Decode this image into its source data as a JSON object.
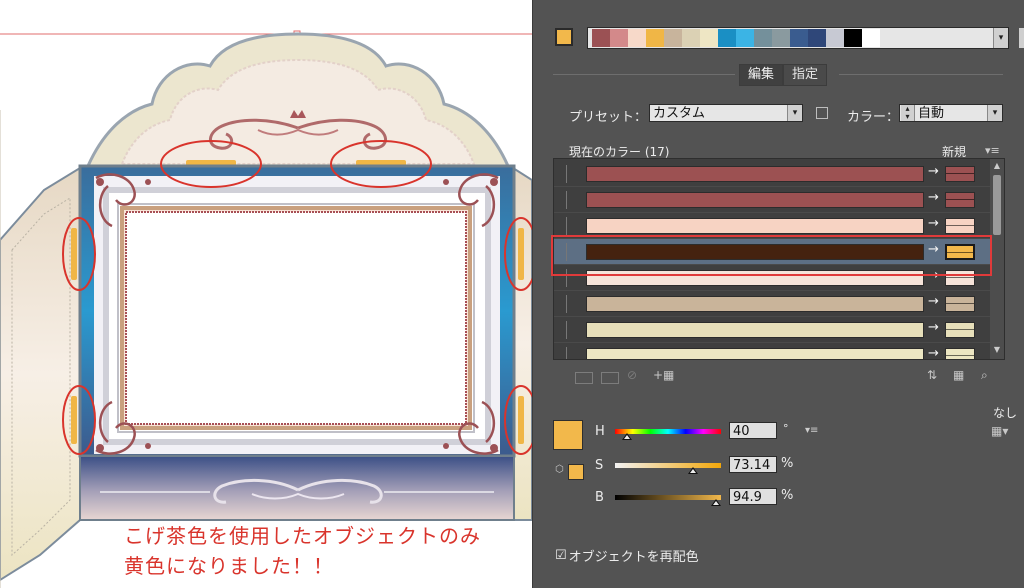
{
  "annotation": {
    "line1": "こげ茶色を使用したオブジェクトのみ",
    "line2": "黄色になりました！！"
  },
  "colors": {
    "accent_yellow": "#f0b646",
    "annotation_red": "#d9342c",
    "panel_bg": "#535353"
  },
  "panel": {
    "active_swatch": "#f2b84b",
    "swatch_strip": [
      "#9b5154",
      "#d3898a",
      "#f7d9c9",
      "#f0b646",
      "#c8b49c",
      "#dbd1b4",
      "#eee6c4",
      "#1a8fc4",
      "#3bb4e5",
      "#74909b",
      "#8a9a9f",
      "#3a5c8f",
      "#2f4779",
      "#c7c9d3",
      "#000000",
      "#ffffff"
    ],
    "tabs": [
      {
        "label": "編集",
        "active": true
      },
      {
        "label": "指定",
        "active": false
      }
    ],
    "preset_label": "プリセット：",
    "preset_value": "カスタム",
    "color_label": "カラー：",
    "color_value": "自動",
    "current_colors_label": "現在のカラー (17)",
    "new_label": "新規",
    "none_label": "なし",
    "color_rows": [
      {
        "current": "#9c5152",
        "new": "#9c5152",
        "selected": false
      },
      {
        "current": "#9c5152",
        "new": "#9c5152",
        "selected": false
      },
      {
        "current": "#f7d3c3",
        "new": "#f7d3c3",
        "selected": false
      },
      {
        "current": "#45220f",
        "new": "#f2b84b",
        "selected": true
      },
      {
        "current": "#f6e3d9",
        "new": "#f6e3d9",
        "selected": false
      },
      {
        "current": "#c9b49a",
        "new": "#c9b49a",
        "selected": false
      },
      {
        "current": "#e7dfba",
        "new": "#e7dfba",
        "selected": false
      },
      {
        "current": "#ece6c2",
        "new": "#ece6c2",
        "selected": false
      }
    ],
    "hsb": {
      "h_label": "H",
      "h_value": "40",
      "h_unit": "°",
      "h_fraction": 0.11,
      "s_label": "S",
      "s_value": "73.14",
      "s_unit": "%",
      "s_fraction": 0.7314,
      "b_label": "B",
      "b_value": "94.9",
      "b_unit": "%",
      "b_fraction": 0.949
    },
    "recolor_label": "オブジェクトを再配色",
    "recolor_checked": true
  }
}
